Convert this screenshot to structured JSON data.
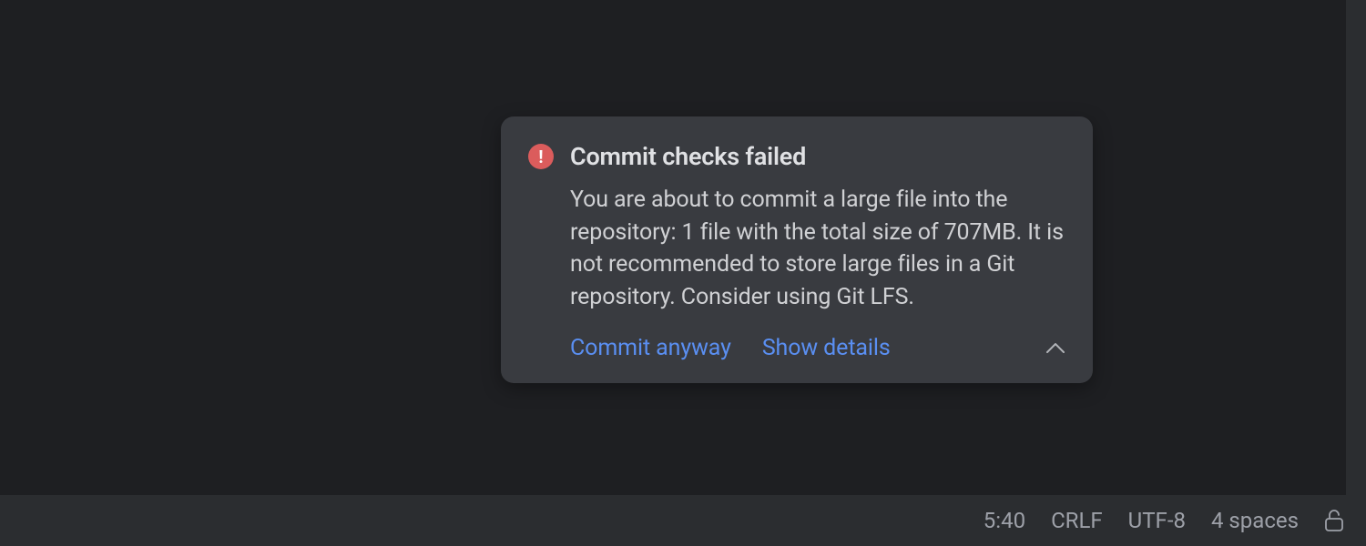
{
  "notification": {
    "title": "Commit checks failed",
    "body": "You are about to commit a large file into the repository: 1 file with the total size of 707MB. It is not recommended to store large files in a Git repository. Consider using Git LFS.",
    "error_glyph": "!",
    "actions": {
      "commit_anyway": "Commit anyway",
      "show_details": "Show details"
    }
  },
  "statusbar": {
    "position": "5:40",
    "line_separator": "CRLF",
    "encoding": "UTF-8",
    "indent": "4 spaces"
  }
}
